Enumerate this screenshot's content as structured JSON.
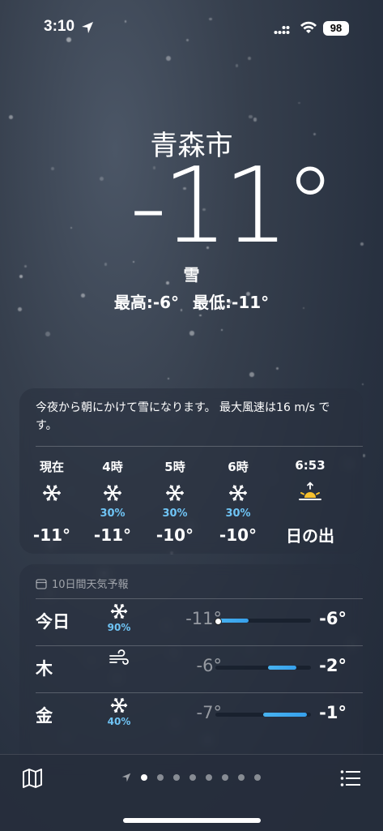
{
  "status": {
    "time": "3:10",
    "battery": "98"
  },
  "location": {
    "city": "青森市",
    "temp": "-11°",
    "condition": "雪",
    "high": "最高:-6°",
    "low": "最低:-11°"
  },
  "hourly": {
    "summary": "今夜から朝にかけて雪になります。 最大風速は16 m/s です。",
    "items": [
      {
        "label": "現在",
        "icon": "snowflake-icon",
        "pct": "",
        "temp": "-11°"
      },
      {
        "label": "4時",
        "icon": "snowflake-icon",
        "pct": "30%",
        "temp": "-11°"
      },
      {
        "label": "5時",
        "icon": "snowflake-icon",
        "pct": "30%",
        "temp": "-10°"
      },
      {
        "label": "6時",
        "icon": "snowflake-icon",
        "pct": "30%",
        "temp": "-10°"
      },
      {
        "label": "6:53",
        "icon": "sunrise-icon",
        "pct": "",
        "temp": "日の出"
      }
    ]
  },
  "daily": {
    "header": "10日間天気予報",
    "rows": [
      {
        "day": "今日",
        "icon": "snowflake-icon",
        "pct": "90%",
        "low": "-11°",
        "high": "-6°",
        "range_start": 0.0,
        "range_end": 0.35,
        "current": 0.0
      },
      {
        "day": "木",
        "icon": "wind-icon",
        "pct": "",
        "low": "-6°",
        "high": "-2°",
        "range_start": 0.55,
        "range_end": 0.85
      },
      {
        "day": "金",
        "icon": "snowflake-icon",
        "pct": "40%",
        "low": "-7°",
        "high": "-1°",
        "range_start": 0.5,
        "range_end": 0.96
      }
    ]
  },
  "colors": {
    "accent_blue": "#6fc4f5",
    "bar_blue": "#3aa4ee"
  },
  "pager": {
    "pages": 8,
    "active": 1
  }
}
